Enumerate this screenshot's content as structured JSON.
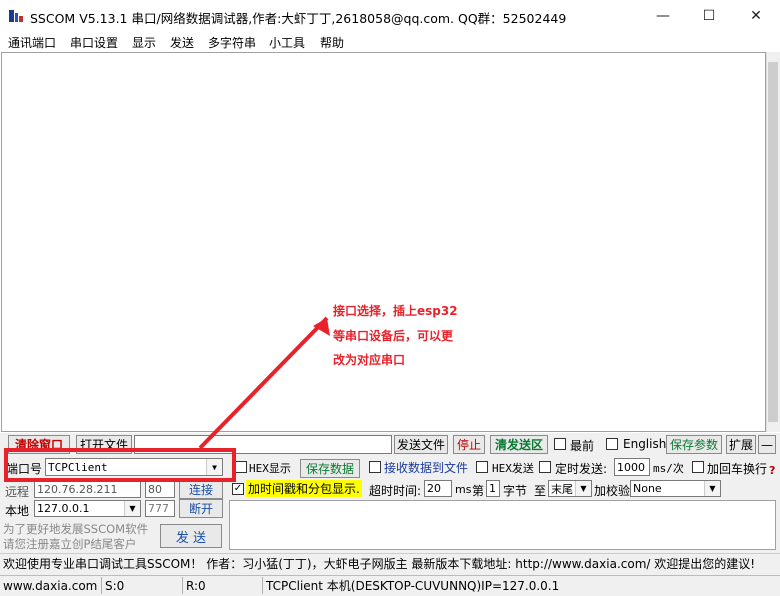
{
  "window": {
    "title": "SSCOM V5.13.1 串口/网络数据调试器,作者:大虾丁丁,2618058@qq.com. QQ群：52502449",
    "minimize": "—",
    "maximize": "☐",
    "close": "✕"
  },
  "menu": [
    "通讯端口",
    "串口设置",
    "显示",
    "发送",
    "多字符串",
    "小工具",
    "帮助"
  ],
  "annotation": {
    "line1": "接口选择，插上esp32",
    "line2": "等串口设备后，可以更",
    "line3": "改为对应串口",
    "color": "#e8222a"
  },
  "toolbar": {
    "clear_window": "清除窗口",
    "open_file": "打开文件",
    "file_path": "",
    "send_file": "发送文件",
    "stop": "停止",
    "clear_send": "清发送区",
    "topmost": "最前",
    "english": "English",
    "save_params": "保存参数",
    "expand": "扩展",
    "collapse": "—"
  },
  "port": {
    "label": "端口号",
    "value": "TCPClient",
    "hex_display": "HEX显示",
    "save_data": "保存数据",
    "recv_to_file": "接收数据到文件",
    "hex_send": "HEX发送",
    "timed_send": "定时发送:",
    "interval": "1000",
    "interval_unit": "ms/次",
    "add_crlf": "加回车换行",
    "help": "?"
  },
  "remote": {
    "label": "远程",
    "ip": "120.76.28.211",
    "port": "80",
    "connect": "连接"
  },
  "local": {
    "label": "本地",
    "ip": "127.0.0.1",
    "port": "777",
    "disconnect": "断开"
  },
  "options": {
    "timestamp": "加时间戳和分包显示.",
    "timeout_label": "超时时间:",
    "timeout": "20",
    "timeout_unit": "ms",
    "nth_label": "第",
    "nth": "1",
    "byte_label": "字节",
    "to_label": "至",
    "end": "末尾",
    "checksum_label": "加校验",
    "checksum": "None"
  },
  "promo": {
    "line1": "为了更好地发展SSCOM软件",
    "line2": "请您注册嘉立创P结尾客户",
    "send": "发 送"
  },
  "ticker": "欢迎使用专业串口调试工具SSCOM！  作者：习小猛(丁丁)，大虾电子网版主  最新版本下载地址: http://www.daxia.com/ 欢迎提出您的建议!",
  "status": {
    "site": "www.daxia.com",
    "sent": "S:0",
    "received": "R:0",
    "info": "TCPClient 本机(DESKTOP-CUVUNNQ)IP=127.0.0.1"
  }
}
